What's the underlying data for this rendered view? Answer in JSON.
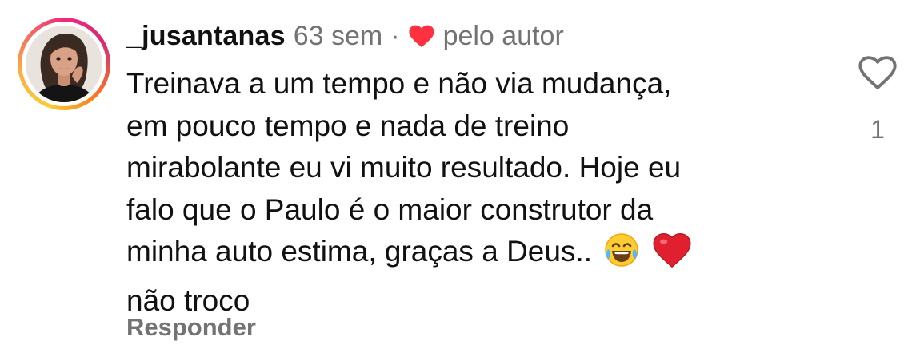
{
  "comment": {
    "username": "_jusantanas",
    "time_ago": "63 sem",
    "separator": "·",
    "author_badge": "pelo autor",
    "author_badge_icon": "heart-icon",
    "author_badge_color": "#ff3040",
    "text_lines": [
      "Treinava a um tempo e não via mudança,",
      "em pouco tempo e nada de treino",
      "mirabolante eu vi muito resultado. Hoje eu",
      "falo que o Paulo é o maior construtor da",
      "minha auto estima, graças a Deus..",
      "não troco"
    ],
    "emojis": [
      "😂",
      "❤️"
    ],
    "reply_label": "Responder",
    "like_icon": "heart-outline-icon",
    "like_count": "1"
  },
  "colors": {
    "text": "#111111",
    "secondary_text": "#737373",
    "heart_red": "#ff3040"
  }
}
